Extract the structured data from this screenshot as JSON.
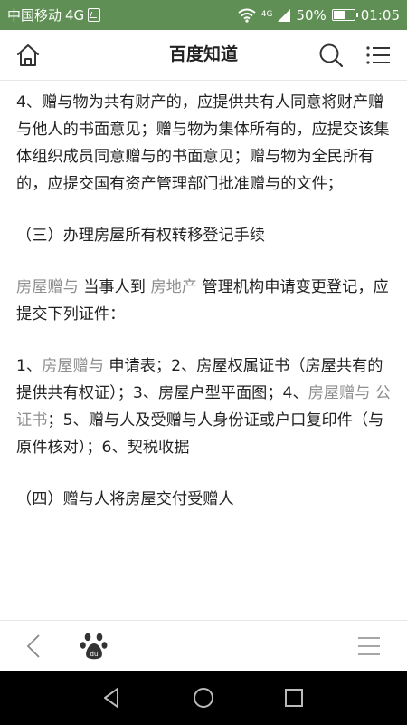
{
  "status": {
    "carrier": "中国移动",
    "network": "4G",
    "net_label": "4G",
    "battery": "50%",
    "battery_level": 0.5,
    "time": "01:05"
  },
  "header": {
    "title": "百度知道"
  },
  "content": {
    "p1": "4、赠与物为共有财产的，应提供共有人同意将财产赠与他人的书面意见；赠与物为集体所有的，应提交该集体组织成员同意赠与的书面意见；赠与物为全民所有的，应提交国有资产管理部门批准赠与的文件；",
    "p2": "（三）办理房屋所有权转移登记手续",
    "p3": {
      "kw1": "房屋赠与",
      "t1": " 当事人到 ",
      "kw2": "房地产",
      "t2": " 管理机构申请变更登记，应提交下列证件："
    },
    "p4": {
      "t1": "1、",
      "kw1": "房屋赠与",
      "t2": " 申请表；2、房屋权属证书（房屋共有的提供共有权证）；3、房屋户型平面图；4、",
      "kw2": "房屋赠与",
      "t3": " ",
      "kw3": "公证书",
      "t4": "；5、赠与人及受赠与人身份证或户口复印件（与原件核对）；6、契税收据"
    },
    "p5": "（四）赠与人将房屋交付受赠人"
  },
  "icons": {
    "home": "home-icon",
    "search": "search-icon",
    "menu": "menu-icon",
    "back": "back-chevron-icon",
    "paw": "baidu-paw-icon",
    "nav_back": "nav-back-icon",
    "nav_home": "nav-home-icon",
    "nav_recent": "nav-recent-icon"
  },
  "colors": {
    "status_bar": "#5f8f54",
    "keyword": "#8f8f8f",
    "text": "#222222"
  }
}
